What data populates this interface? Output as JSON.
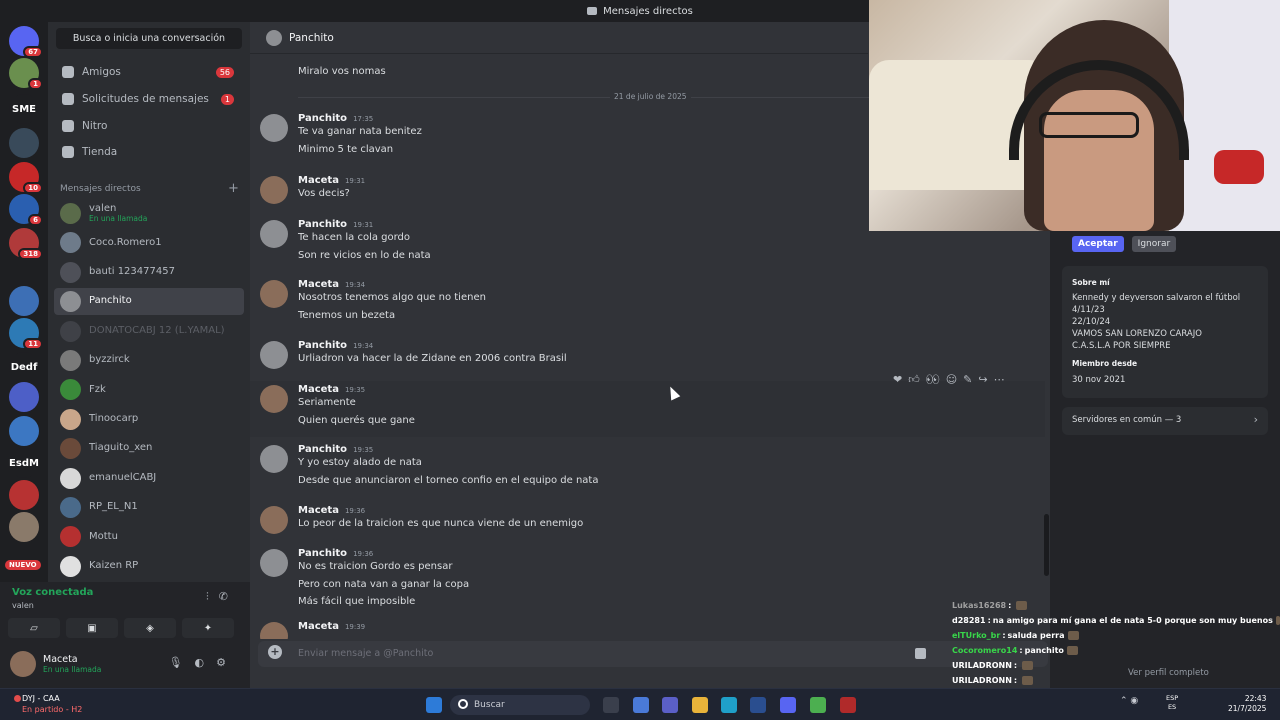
{
  "window": {
    "title": "Mensajes directos"
  },
  "servers": [
    {
      "label": "",
      "badge": "67",
      "color": "#5865f2"
    },
    {
      "label": "",
      "badge": "1",
      "color": "#6a8f4e"
    },
    {
      "label": "SME",
      "badge": "",
      "color": "#1e1f22"
    },
    {
      "label": "",
      "badge": "",
      "color": "#394a5a"
    },
    {
      "label": "",
      "badge": "10",
      "color": "#c62828"
    },
    {
      "label": "",
      "badge": "6",
      "color": "#2a5fb0"
    },
    {
      "label": "",
      "badge": "318",
      "color": "#b03a3a"
    },
    {
      "label": "",
      "badge": "",
      "color": "#3d6fb5"
    },
    {
      "label": "",
      "badge": "11",
      "color": "#2d7ab5"
    },
    {
      "label": "Dedf",
      "badge": "",
      "color": "#1e1f22"
    },
    {
      "label": "",
      "badge": "",
      "color": "#4d5fc7"
    },
    {
      "label": "",
      "badge": "",
      "color": "#3c77c2"
    },
    {
      "label": "EsdM",
      "badge": "",
      "color": "#1e1f22"
    },
    {
      "label": "",
      "badge": "",
      "color": "#b73232"
    },
    {
      "label": "",
      "badge": "",
      "color": "#8a7a6a"
    }
  ],
  "new_badge": "NUEVO",
  "sidebar": {
    "search": "Busca o inicia una conversación",
    "nav": [
      {
        "label": "Amigos",
        "count": "56"
      },
      {
        "label": "Solicitudes de mensajes",
        "count": "1"
      },
      {
        "label": "Nitro",
        "count": ""
      },
      {
        "label": "Tienda",
        "count": ""
      }
    ],
    "section_title": "Mensajes directos",
    "section_add": "+",
    "dms": [
      {
        "name": "valen",
        "sub": "En una llamada",
        "color": "#5a6b4a"
      },
      {
        "name": "Coco.Romero1",
        "sub": "",
        "color": "#6e7b8a"
      },
      {
        "name": "bauti 123477457",
        "sub": "",
        "color": "#4e5058"
      },
      {
        "name": "Panchito",
        "sub": "",
        "color": "#8d8f93"
      },
      {
        "name": "DONATOCABJ 12 (L.YAMAL)",
        "sub": "",
        "color": "#3f4147"
      },
      {
        "name": "byzzirck",
        "sub": "",
        "color": "#7a7a7a"
      },
      {
        "name": "Fzk",
        "sub": "",
        "color": "#3a8a3a"
      },
      {
        "name": "Tinoocarp",
        "sub": "",
        "color": "#c9a68a"
      },
      {
        "name": "Tiaguito_xen",
        "sub": "",
        "color": "#6a4a3a"
      },
      {
        "name": "emanuelCABJ",
        "sub": "",
        "color": "#d8d8d8"
      },
      {
        "name": "RP_EL_N1",
        "sub": "",
        "color": "#4a6a8a"
      },
      {
        "name": "Mottu",
        "sub": "",
        "color": "#b53030"
      },
      {
        "name": "Kaizen RP",
        "sub": "",
        "color": "#e0e0e0"
      }
    ]
  },
  "voice": {
    "status": "Voz conectada",
    "channel": "valen"
  },
  "user": {
    "name": "Maceta",
    "status": "En una llamada"
  },
  "chat": {
    "header_name": "Panchito",
    "first_line": "Miralo vos nomas",
    "date_separator": "21 de julio de 2025",
    "messages": [
      {
        "author": "Panchito",
        "time": "17:35",
        "lines": [
          "Te va ganar nata benitez",
          "Minimo 5 te clavan"
        ]
      },
      {
        "author": "Maceta",
        "time": "19:31",
        "lines": [
          "Vos decis?"
        ]
      },
      {
        "author": "Panchito",
        "time": "19:31",
        "lines": [
          "Te hacen la cola gordo",
          "Son re vicios en lo de nata"
        ]
      },
      {
        "author": "Maceta",
        "time": "19:34",
        "lines": [
          "Nosotros tenemos algo que no tienen",
          "Tenemos un bezeta"
        ]
      },
      {
        "author": "Panchito",
        "time": "19:34",
        "lines": [
          "Urliadron va hacer la de Zidane en 2006 contra Brasil"
        ]
      },
      {
        "author": "Maceta",
        "time": "19:35",
        "lines": [
          "Seriamente",
          "Quien querés que gane"
        ]
      },
      {
        "author": "Panchito",
        "time": "19:35",
        "lines": [
          "Y yo estoy alado de nata",
          "Desde que anunciaron el torneo confio en el equipo de nata"
        ]
      },
      {
        "author": "Maceta",
        "time": "19:36",
        "lines": [
          "Lo peor de la traicion es que nunca viene de un enemigo"
        ]
      },
      {
        "author": "Panchito",
        "time": "19:36",
        "lines": [
          "No es traicion Gordo es pensar",
          "Pero con nata van a ganar la copa",
          "Más fácil que imposible"
        ]
      },
      {
        "author": "Maceta",
        "time": "19:39",
        "lines": []
      }
    ],
    "input_placeholder": "Enviar mensaje a @Panchito"
  },
  "profile": {
    "accept": "Aceptar",
    "ignore": "Ignorar",
    "about_title": "Sobre mí",
    "about_lines": [
      "Kennedy y deyverson salvaron el fútbol",
      "4/11/23",
      "22/10/24",
      "VAMOS SAN LORENZO CARAJO",
      "C.A.S.L.A POR SIEMPRE"
    ],
    "member_since_title": "Miembro desde",
    "member_since": "30 nov 2021",
    "mutual_servers": "Servidores en común — 3",
    "full_profile": "Ver perfil completo"
  },
  "stream_chat": [
    {
      "user": "Lukas16268",
      "text": "",
      "color": "#a0a0a0"
    },
    {
      "user": "d28281",
      "text": "na amigo para mí gana el de nata 5-0 porque son muy buenos",
      "color": "#ffffff"
    },
    {
      "user": "elTUrko_br",
      "text": "saluda perra",
      "color": "#38d64a"
    },
    {
      "user": "Cocoromero14",
      "text": "panchito",
      "color": "#38d64a"
    },
    {
      "user": "URILADRONN",
      "text": "",
      "color": "#ffffff"
    },
    {
      "user": "URILADRONN",
      "text": "",
      "color": "#ffffff"
    }
  ],
  "taskbar": {
    "game_title": "DYJ - CAA",
    "game_sub": "En partido - H2",
    "search": "Buscar",
    "lang": "ESP",
    "lang_sub": "ES",
    "time": "22:43",
    "date": "21/7/2025"
  }
}
